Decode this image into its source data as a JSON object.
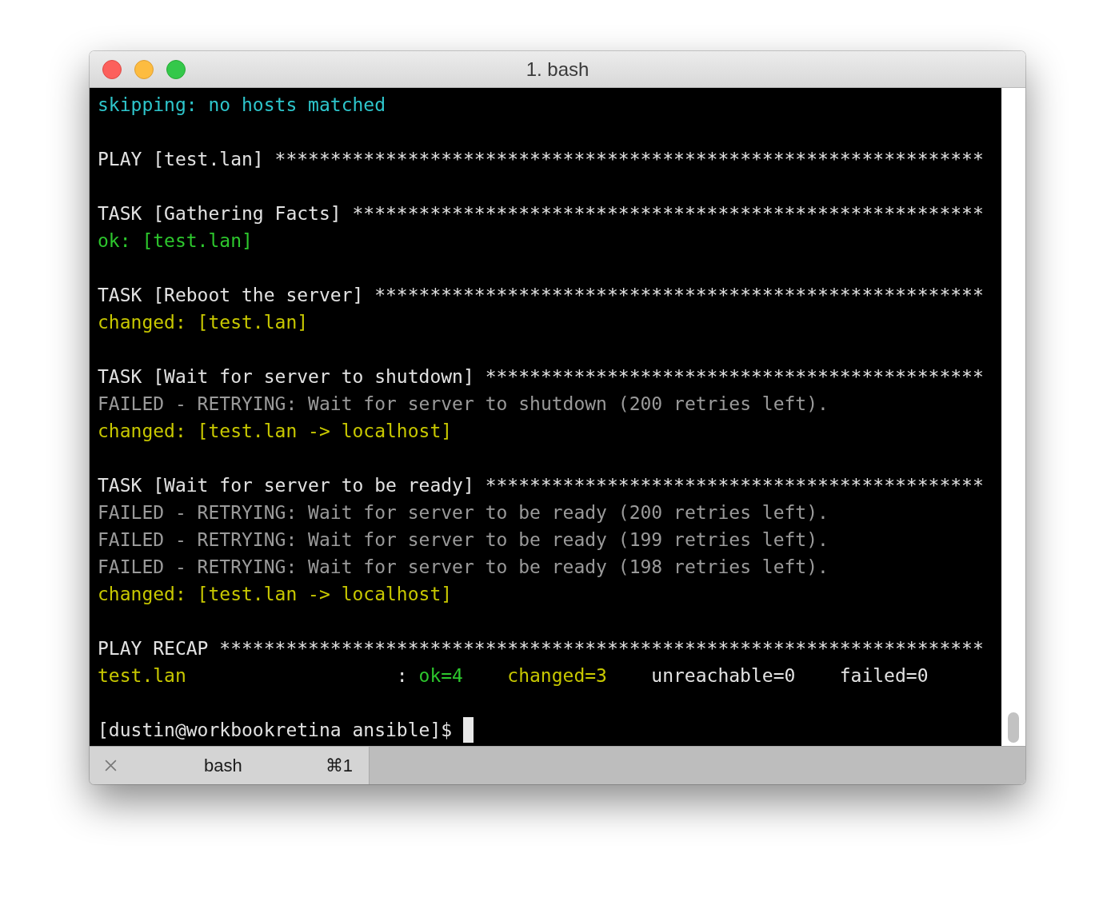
{
  "window": {
    "title": "1. bash"
  },
  "terminal": {
    "blocks": [
      [
        [
          {
            "text": "skipping: no hosts matched",
            "kind": "skipping"
          }
        ]
      ],
      [
        [
          {
            "text": "PLAY [test.lan] ****************************************************************",
            "kind": "plain"
          }
        ]
      ],
      [
        [
          {
            "text": "TASK [Gathering Facts] *********************************************************",
            "kind": "plain"
          }
        ],
        [
          {
            "text": "ok: [test.lan]",
            "kind": "ok"
          }
        ]
      ],
      [
        [
          {
            "text": "TASK [Reboot the server] *******************************************************",
            "kind": "plain"
          }
        ],
        [
          {
            "text": "changed: [test.lan]",
            "kind": "changed"
          }
        ]
      ],
      [
        [
          {
            "text": "TASK [Wait for server to shutdown] *********************************************",
            "kind": "plain"
          }
        ],
        [
          {
            "text": "FAILED - RETRYING: Wait for server to shutdown (200 retries left).",
            "kind": "failed"
          }
        ],
        [
          {
            "text": "changed: [test.lan -> localhost]",
            "kind": "changed"
          }
        ]
      ],
      [
        [
          {
            "text": "TASK [Wait for server to be ready] *********************************************",
            "kind": "plain"
          }
        ],
        [
          {
            "text": "FAILED - RETRYING: Wait for server to be ready (200 retries left).",
            "kind": "failed"
          }
        ],
        [
          {
            "text": "FAILED - RETRYING: Wait for server to be ready (199 retries left).",
            "kind": "failed"
          }
        ],
        [
          {
            "text": "FAILED - RETRYING: Wait for server to be ready (198 retries left).",
            "kind": "failed"
          }
        ],
        [
          {
            "text": "changed: [test.lan -> localhost]",
            "kind": "changed"
          }
        ]
      ],
      [
        [
          {
            "text": "PLAY RECAP *********************************************************************",
            "kind": "plain"
          }
        ]
      ]
    ],
    "recap": {
      "host": "test.lan",
      "separator": ":",
      "stats": [
        {
          "text": "ok=4",
          "kind": "ok"
        },
        {
          "text": "changed=3",
          "kind": "changed"
        },
        {
          "text": "unreachable=0",
          "kind": "plain"
        },
        {
          "text": "failed=0",
          "kind": "plain"
        }
      ]
    },
    "prompt": "[dustin@workbookretina ansible]$"
  },
  "tabs": [
    {
      "label": "bash",
      "shortcut": "⌘1",
      "selected": true
    }
  ]
}
